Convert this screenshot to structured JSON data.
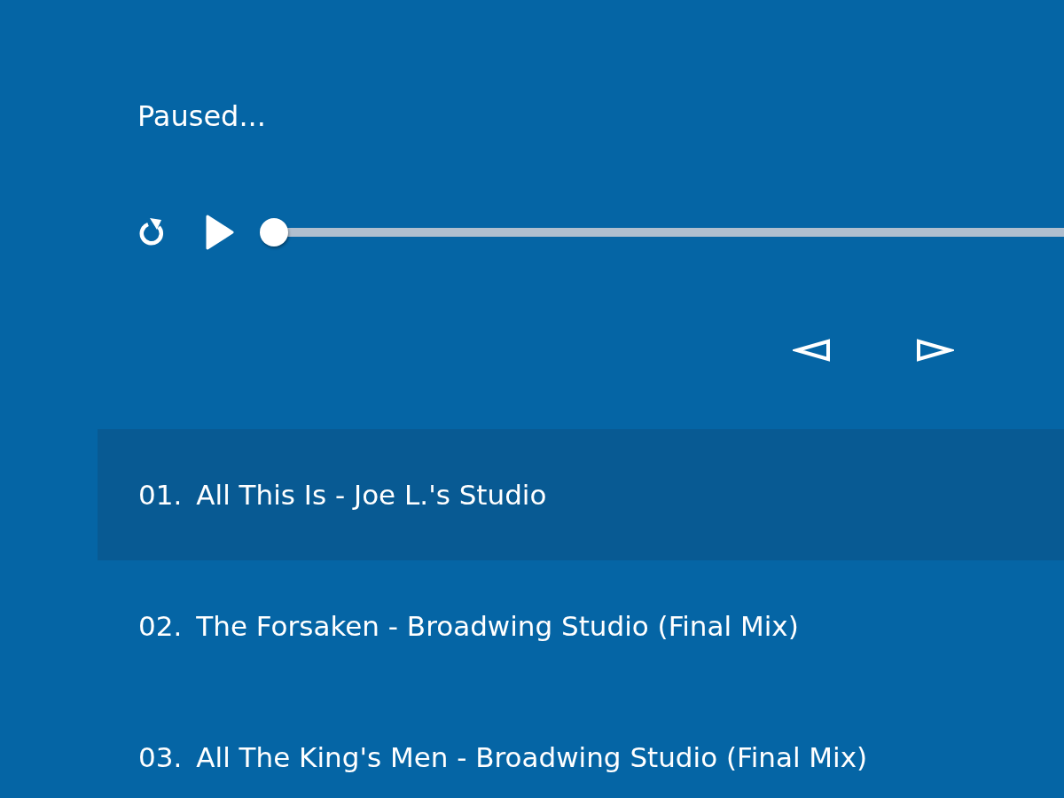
{
  "status": "Paused...",
  "player": {
    "playing": false,
    "level": 0
  },
  "tracks": [
    {
      "number": "01.",
      "title": "All This Is - Joe L.'s Studio",
      "selected": true
    },
    {
      "number": "02.",
      "title": "The Forsaken - Broadwing Studio (Final Mix)",
      "selected": false
    },
    {
      "number": "03.",
      "title": "All The King's Men - Broadwing Studio (Final Mix)",
      "selected": false
    }
  ]
}
